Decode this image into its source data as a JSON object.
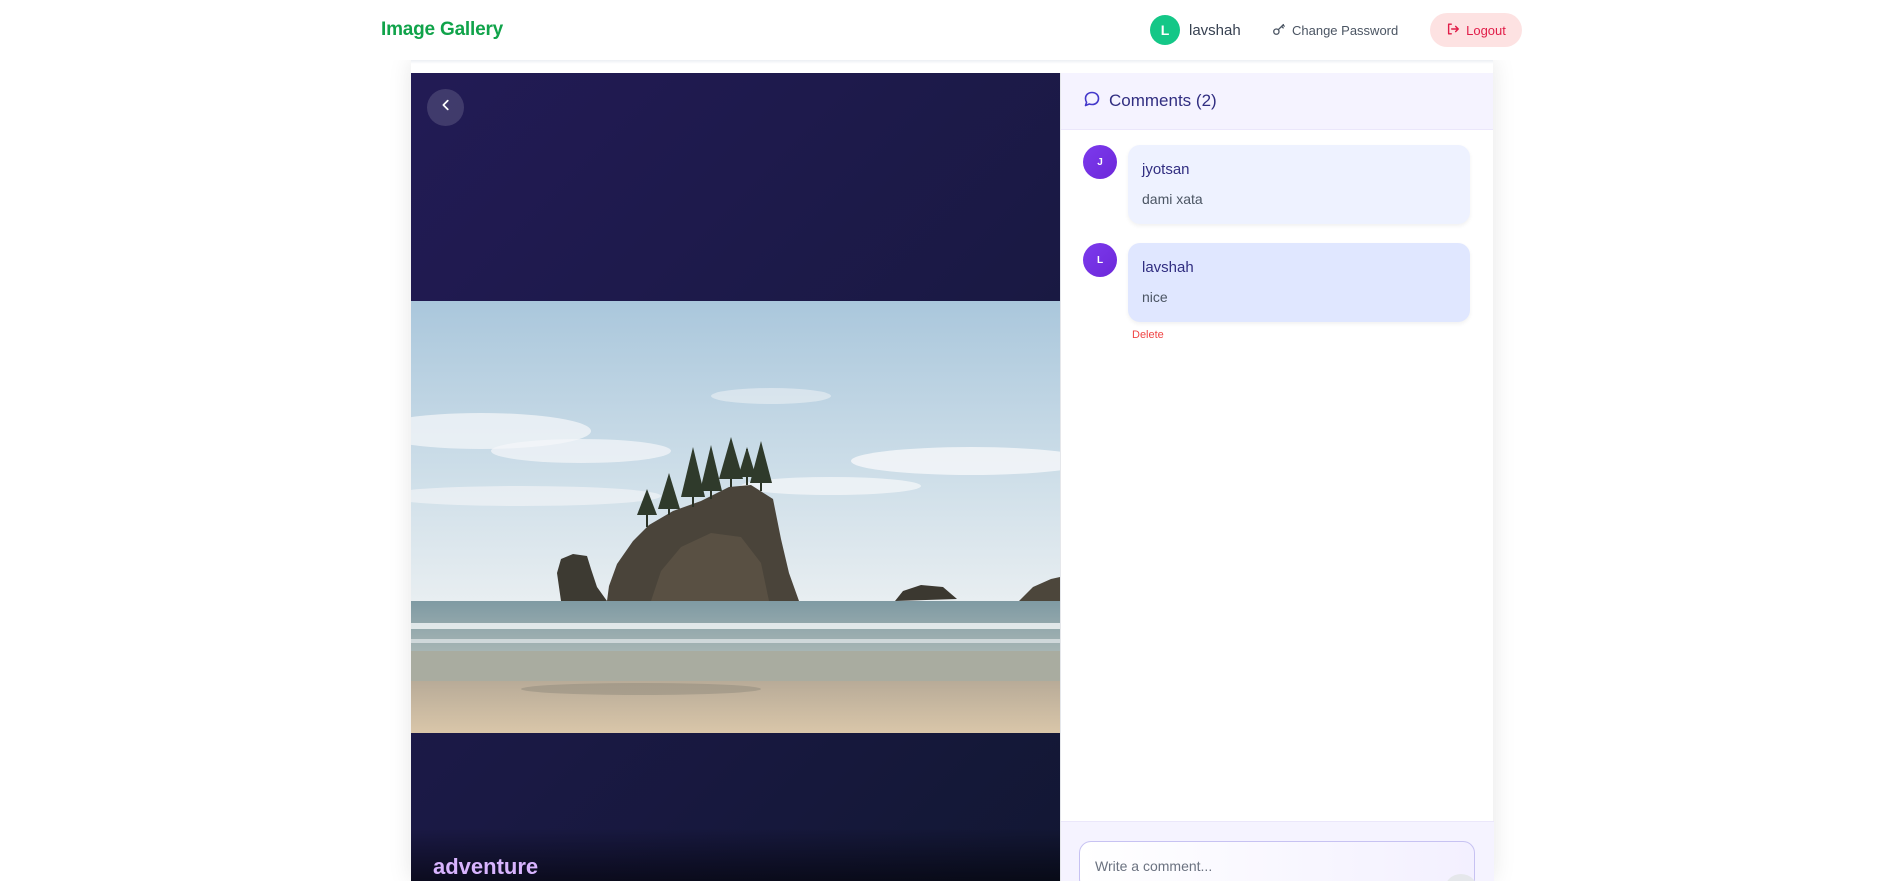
{
  "header": {
    "brand": "Image Gallery",
    "user_initial": "L",
    "username": "lavshah",
    "change_password_label": "Change Password",
    "logout_label": "Logout"
  },
  "image": {
    "caption": "adventure"
  },
  "comments": {
    "title": "Comments (2)",
    "items": [
      {
        "initial": "J",
        "author": "jyotsan",
        "text": "dami xata"
      },
      {
        "initial": "L",
        "author": "lavshah",
        "text": "nice",
        "delete_label": "Delete"
      }
    ],
    "input_placeholder": "Write a comment..."
  },
  "colors": {
    "brand": "#10a34a",
    "accent": "#7c3aed",
    "logout": "#e11d48",
    "panel_dark": "#1a1944"
  }
}
